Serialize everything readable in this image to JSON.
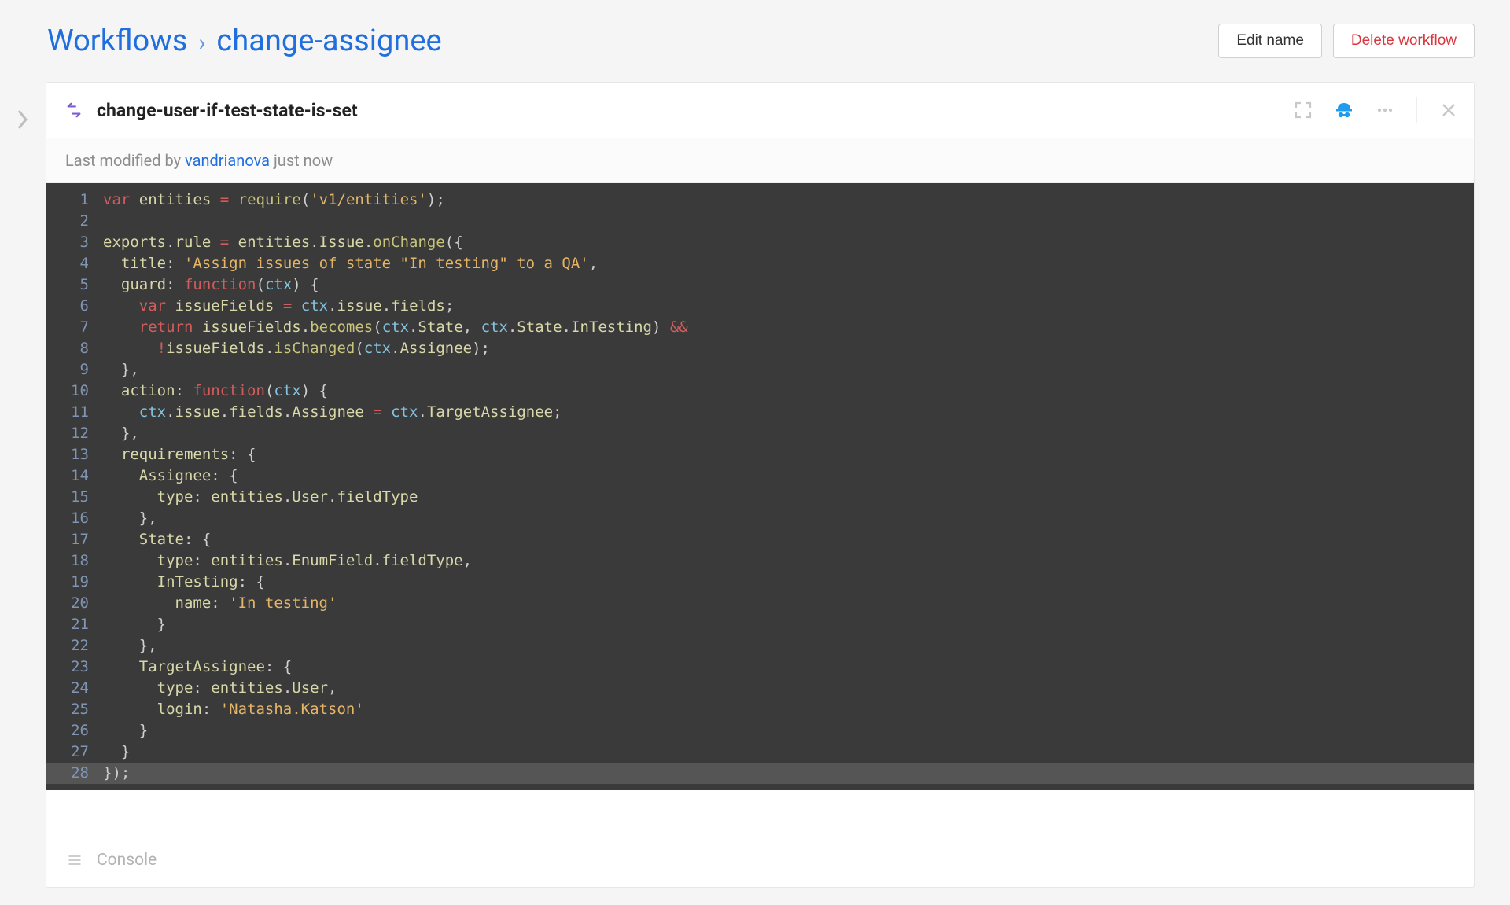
{
  "breadcrumb": {
    "root": "Workflows",
    "separator": "›",
    "current": "change-assignee"
  },
  "header_actions": {
    "edit_name": "Edit name",
    "delete_workflow": "Delete workflow"
  },
  "panel": {
    "rule_title": "change-user-if-test-state-is-set",
    "modified_prefix": "Last modified by ",
    "modified_user": "vandrianova",
    "modified_suffix": " just now",
    "console_label": "Console"
  },
  "tool_icons": {
    "expand": "fullscreen-icon",
    "incognito": "incognito-icon",
    "more": "more-icon",
    "close": "close-icon"
  },
  "code": {
    "lines": [
      {
        "n": 1,
        "segs": [
          [
            "kw",
            "var"
          ],
          [
            "plain",
            " "
          ],
          [
            "ident",
            "entities"
          ],
          [
            "plain",
            " "
          ],
          [
            "op",
            "="
          ],
          [
            "plain",
            " "
          ],
          [
            "fn",
            "require"
          ],
          [
            "punc",
            "("
          ],
          [
            "str",
            "'v1/entities'"
          ],
          [
            "punc",
            ");"
          ]
        ]
      },
      {
        "n": 2,
        "segs": []
      },
      {
        "n": 3,
        "segs": [
          [
            "ident",
            "exports"
          ],
          [
            "punc",
            "."
          ],
          [
            "ident",
            "rule"
          ],
          [
            "plain",
            " "
          ],
          [
            "op",
            "="
          ],
          [
            "plain",
            " "
          ],
          [
            "ident",
            "entities"
          ],
          [
            "punc",
            "."
          ],
          [
            "ident",
            "Issue"
          ],
          [
            "punc",
            "."
          ],
          [
            "fn",
            "onChange"
          ],
          [
            "punc",
            "({"
          ]
        ]
      },
      {
        "n": 4,
        "segs": [
          [
            "plain",
            "  "
          ],
          [
            "ident",
            "title"
          ],
          [
            "punc",
            ": "
          ],
          [
            "str",
            "'Assign issues of state \"In testing\" to a QA'"
          ],
          [
            "punc",
            ","
          ]
        ]
      },
      {
        "n": 5,
        "segs": [
          [
            "plain",
            "  "
          ],
          [
            "ident",
            "guard"
          ],
          [
            "punc",
            ": "
          ],
          [
            "kw",
            "function"
          ],
          [
            "punc",
            "("
          ],
          [
            "param",
            "ctx"
          ],
          [
            "punc",
            ") {"
          ]
        ]
      },
      {
        "n": 6,
        "segs": [
          [
            "plain",
            "    "
          ],
          [
            "kw",
            "var"
          ],
          [
            "plain",
            " "
          ],
          [
            "ident",
            "issueFields"
          ],
          [
            "plain",
            " "
          ],
          [
            "op",
            "="
          ],
          [
            "plain",
            " "
          ],
          [
            "param",
            "ctx"
          ],
          [
            "punc",
            "."
          ],
          [
            "ident",
            "issue"
          ],
          [
            "punc",
            "."
          ],
          [
            "ident",
            "fields"
          ],
          [
            "punc",
            ";"
          ]
        ]
      },
      {
        "n": 7,
        "segs": [
          [
            "plain",
            "    "
          ],
          [
            "kw",
            "return"
          ],
          [
            "plain",
            " "
          ],
          [
            "ident",
            "issueFields"
          ],
          [
            "punc",
            "."
          ],
          [
            "fn",
            "becomes"
          ],
          [
            "punc",
            "("
          ],
          [
            "param",
            "ctx"
          ],
          [
            "punc",
            "."
          ],
          [
            "ident",
            "State"
          ],
          [
            "punc",
            ", "
          ],
          [
            "param",
            "ctx"
          ],
          [
            "punc",
            "."
          ],
          [
            "ident",
            "State"
          ],
          [
            "punc",
            "."
          ],
          [
            "ident",
            "InTesting"
          ],
          [
            "punc",
            ") "
          ],
          [
            "op",
            "&&"
          ]
        ]
      },
      {
        "n": 8,
        "segs": [
          [
            "plain",
            "      "
          ],
          [
            "op",
            "!"
          ],
          [
            "ident",
            "issueFields"
          ],
          [
            "punc",
            "."
          ],
          [
            "fn",
            "isChanged"
          ],
          [
            "punc",
            "("
          ],
          [
            "param",
            "ctx"
          ],
          [
            "punc",
            "."
          ],
          [
            "ident",
            "Assignee"
          ],
          [
            "punc",
            ");"
          ]
        ]
      },
      {
        "n": 9,
        "segs": [
          [
            "plain",
            "  "
          ],
          [
            "punc",
            "},"
          ]
        ]
      },
      {
        "n": 10,
        "segs": [
          [
            "plain",
            "  "
          ],
          [
            "ident",
            "action"
          ],
          [
            "punc",
            ": "
          ],
          [
            "kw",
            "function"
          ],
          [
            "punc",
            "("
          ],
          [
            "param",
            "ctx"
          ],
          [
            "punc",
            ") {"
          ]
        ]
      },
      {
        "n": 11,
        "segs": [
          [
            "plain",
            "    "
          ],
          [
            "param",
            "ctx"
          ],
          [
            "punc",
            "."
          ],
          [
            "ident",
            "issue"
          ],
          [
            "punc",
            "."
          ],
          [
            "ident",
            "fields"
          ],
          [
            "punc",
            "."
          ],
          [
            "ident",
            "Assignee"
          ],
          [
            "plain",
            " "
          ],
          [
            "op",
            "="
          ],
          [
            "plain",
            " "
          ],
          [
            "param",
            "ctx"
          ],
          [
            "punc",
            "."
          ],
          [
            "ident",
            "TargetAssignee"
          ],
          [
            "punc",
            ";"
          ]
        ]
      },
      {
        "n": 12,
        "segs": [
          [
            "plain",
            "  "
          ],
          [
            "punc",
            "},"
          ]
        ]
      },
      {
        "n": 13,
        "segs": [
          [
            "plain",
            "  "
          ],
          [
            "ident",
            "requirements"
          ],
          [
            "punc",
            ": {"
          ]
        ]
      },
      {
        "n": 14,
        "segs": [
          [
            "plain",
            "    "
          ],
          [
            "ident",
            "Assignee"
          ],
          [
            "punc",
            ": {"
          ]
        ]
      },
      {
        "n": 15,
        "segs": [
          [
            "plain",
            "      "
          ],
          [
            "ident",
            "type"
          ],
          [
            "punc",
            ": "
          ],
          [
            "ident",
            "entities"
          ],
          [
            "punc",
            "."
          ],
          [
            "ident",
            "User"
          ],
          [
            "punc",
            "."
          ],
          [
            "ident",
            "fieldType"
          ]
        ]
      },
      {
        "n": 16,
        "segs": [
          [
            "plain",
            "    "
          ],
          [
            "punc",
            "},"
          ]
        ]
      },
      {
        "n": 17,
        "segs": [
          [
            "plain",
            "    "
          ],
          [
            "ident",
            "State"
          ],
          [
            "punc",
            ": {"
          ]
        ]
      },
      {
        "n": 18,
        "segs": [
          [
            "plain",
            "      "
          ],
          [
            "ident",
            "type"
          ],
          [
            "punc",
            ": "
          ],
          [
            "ident",
            "entities"
          ],
          [
            "punc",
            "."
          ],
          [
            "ident",
            "EnumField"
          ],
          [
            "punc",
            "."
          ],
          [
            "ident",
            "fieldType"
          ],
          [
            "punc",
            ","
          ]
        ]
      },
      {
        "n": 19,
        "segs": [
          [
            "plain",
            "      "
          ],
          [
            "ident",
            "InTesting"
          ],
          [
            "punc",
            ": {"
          ]
        ]
      },
      {
        "n": 20,
        "segs": [
          [
            "plain",
            "        "
          ],
          [
            "ident",
            "name"
          ],
          [
            "punc",
            ": "
          ],
          [
            "str",
            "'In testing'"
          ]
        ]
      },
      {
        "n": 21,
        "segs": [
          [
            "plain",
            "      "
          ],
          [
            "punc",
            "}"
          ]
        ]
      },
      {
        "n": 22,
        "segs": [
          [
            "plain",
            "    "
          ],
          [
            "punc",
            "},"
          ]
        ]
      },
      {
        "n": 23,
        "segs": [
          [
            "plain",
            "    "
          ],
          [
            "ident",
            "TargetAssignee"
          ],
          [
            "punc",
            ": {"
          ]
        ]
      },
      {
        "n": 24,
        "segs": [
          [
            "plain",
            "      "
          ],
          [
            "ident",
            "type"
          ],
          [
            "punc",
            ": "
          ],
          [
            "ident",
            "entities"
          ],
          [
            "punc",
            "."
          ],
          [
            "ident",
            "User"
          ],
          [
            "punc",
            ","
          ]
        ]
      },
      {
        "n": 25,
        "segs": [
          [
            "plain",
            "      "
          ],
          [
            "ident",
            "login"
          ],
          [
            "punc",
            ": "
          ],
          [
            "str",
            "'Natasha.Katson'"
          ]
        ]
      },
      {
        "n": 26,
        "segs": [
          [
            "plain",
            "    "
          ],
          [
            "punc",
            "}"
          ]
        ]
      },
      {
        "n": 27,
        "segs": [
          [
            "plain",
            "  "
          ],
          [
            "punc",
            "}"
          ]
        ]
      },
      {
        "n": 28,
        "segs": [
          [
            "punc",
            "});"
          ]
        ],
        "highlight": true
      }
    ]
  }
}
